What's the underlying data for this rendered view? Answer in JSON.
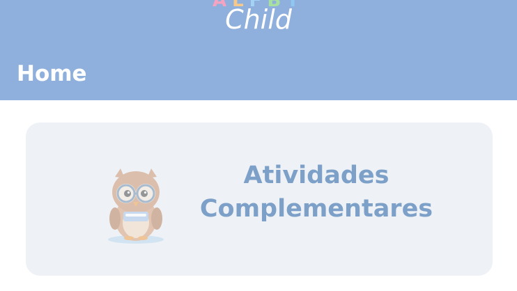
{
  "app": {
    "logo_letters": [
      "A",
      "L",
      "F",
      "B",
      "T"
    ],
    "logo_letter_colors": [
      "#f5a3c0",
      "#f6c98a",
      "#a3d3f5",
      "#a8e0a0",
      "#8ec8f2"
    ],
    "logo_word": "Child"
  },
  "header": {
    "title": "Home",
    "background_color": "#8fb0dc"
  },
  "main": {
    "cards": [
      {
        "label_line1": "Atividades",
        "label_line2": "Complementares",
        "icon": "owl-mascot-icon",
        "label_color": "#7da0c8"
      }
    ]
  }
}
